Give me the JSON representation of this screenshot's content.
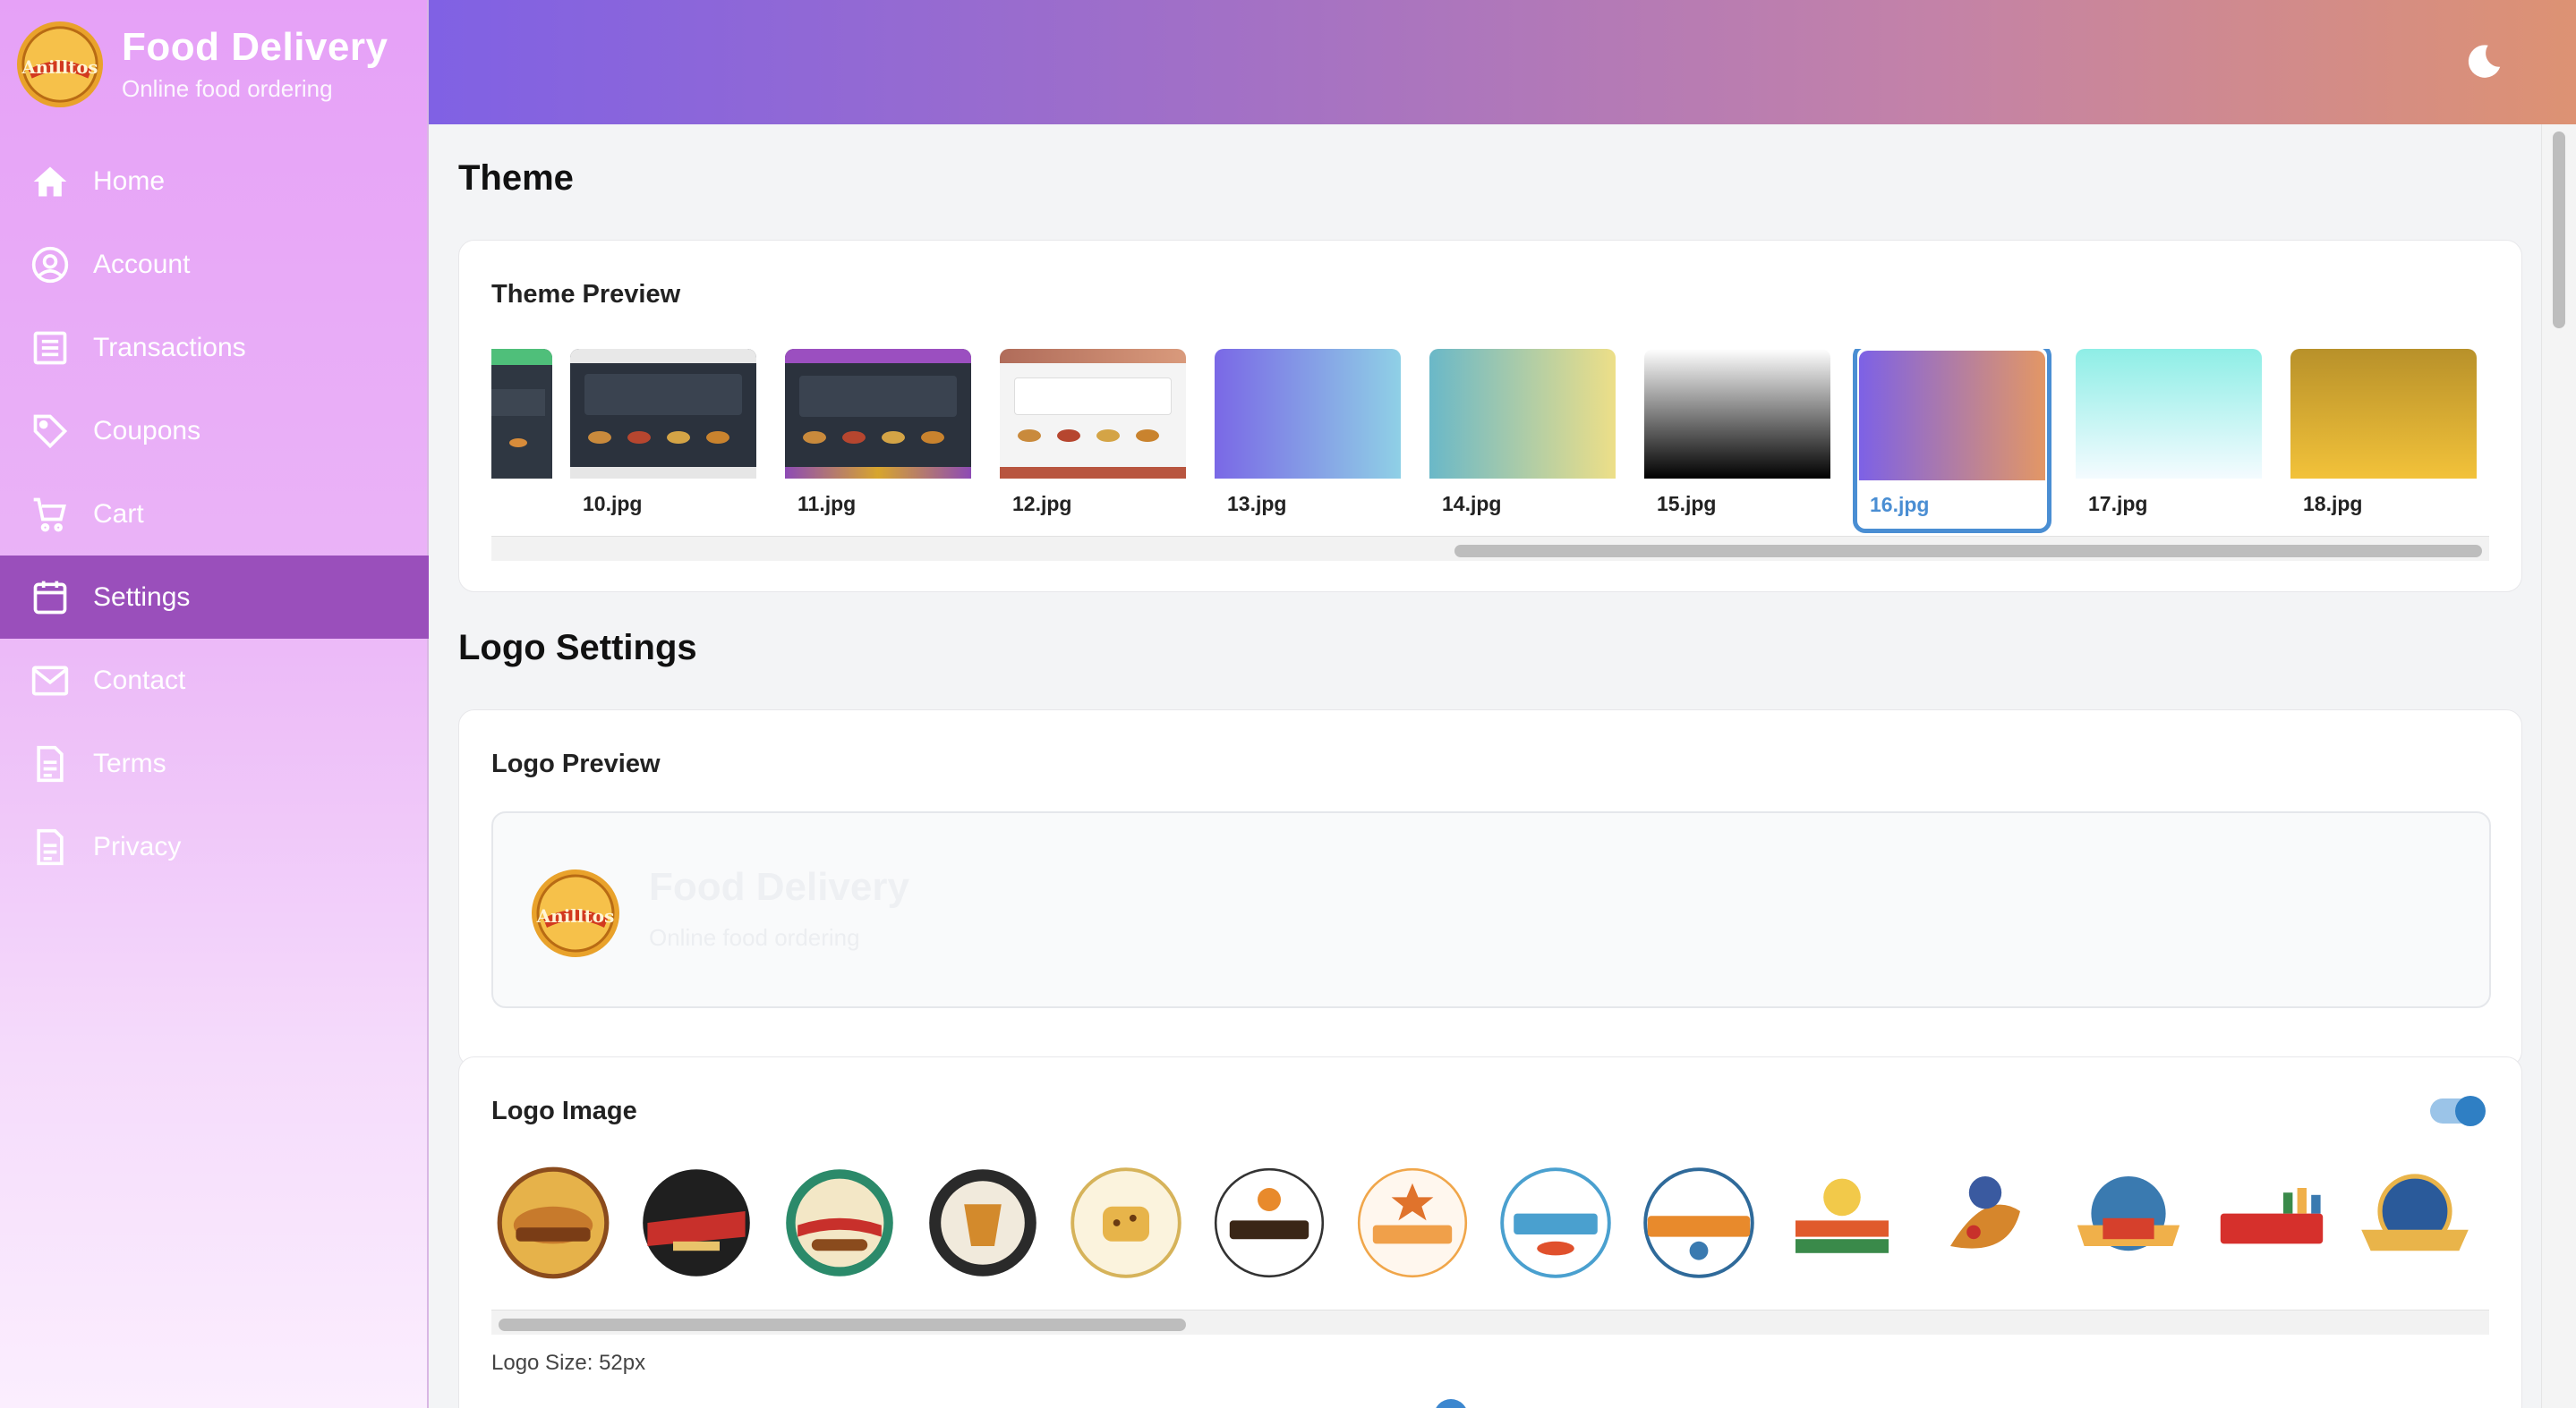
{
  "brand": {
    "title": "Food Delivery",
    "subtitle": "Online food ordering",
    "logo_icon": "anilltos-logo"
  },
  "nav": [
    {
      "label": "Home",
      "icon": "home-icon"
    },
    {
      "label": "Account",
      "icon": "account-icon"
    },
    {
      "label": "Transactions",
      "icon": "transactions-icon"
    },
    {
      "label": "Coupons",
      "icon": "coupon-icon"
    },
    {
      "label": "Cart",
      "icon": "cart-icon"
    },
    {
      "label": "Settings",
      "icon": "calendar-icon",
      "active": true
    },
    {
      "label": "Contact",
      "icon": "mail-icon"
    },
    {
      "label": "Terms",
      "icon": "document-icon"
    },
    {
      "label": "Privacy",
      "icon": "document-icon"
    }
  ],
  "header": {
    "theme_toggle_icon": "moon-icon"
  },
  "theme": {
    "section_title": "Theme",
    "preview_title": "Theme Preview",
    "thumbnails": [
      {
        "label": "10.jpg"
      },
      {
        "label": "11.jpg"
      },
      {
        "label": "12.jpg"
      },
      {
        "label": "13.jpg"
      },
      {
        "label": "14.jpg"
      },
      {
        "label": "15.jpg"
      },
      {
        "label": "16.jpg",
        "selected": true
      },
      {
        "label": "17.jpg"
      },
      {
        "label": "18.jpg"
      }
    ]
  },
  "logo_settings": {
    "section_title": "Logo Settings",
    "preview_title": "Logo Preview",
    "preview_brand_title": "Food Delivery",
    "preview_brand_subtitle": "Online food ordering",
    "image_title": "Logo Image",
    "logo_image_enabled": true,
    "size_label": "Logo Size: 52px",
    "size_value_fraction": 0.48
  },
  "colors": {
    "accent": "#4a8ed3",
    "active_nav": "#9a4fbb"
  }
}
